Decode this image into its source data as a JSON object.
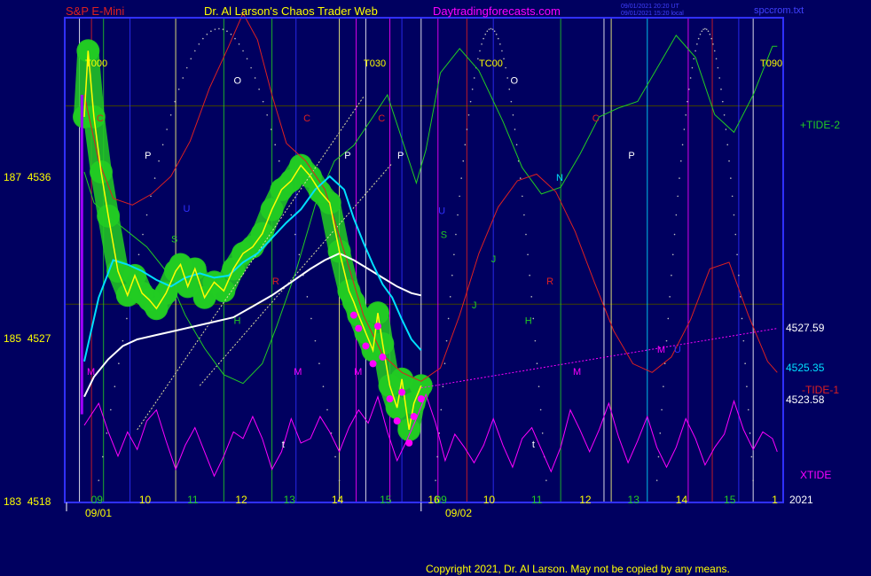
{
  "header": {
    "instrument": "S&P E-Mini",
    "author": "Dr. Al Larson's Chaos Trader Web",
    "site": "Daytradingforecasts.com",
    "stamp_line1": "09/01/2021 20:20 UT",
    "stamp_line2": "09/01/2021 15:20 local",
    "file": "spccrom.txt"
  },
  "footer": {
    "copyright": "Copyright 2021, Dr. Al Larson. May not be copied by any means."
  },
  "colors": {
    "background": "#000060",
    "frame": "#3030ff",
    "price": "#ffff00",
    "band": "#22cc22",
    "ma_fast": "#00e0ff",
    "ma_slow": "#ffffff",
    "tide_plus": "#22cc22",
    "tide_minus": "#dd2020",
    "xtide": "#ff00ff",
    "stamp": "#4040ff"
  },
  "chart_data": {
    "type": "line",
    "y_axis": {
      "range": [
        4518,
        4540
      ],
      "ticks": [
        {
          "value": 4536,
          "label": "187  4536"
        },
        {
          "value": 4527,
          "label": "185  4527"
        },
        {
          "value": 4518,
          "label": "183  4518"
        }
      ]
    },
    "x_axis": {
      "hours_day1": [
        "09",
        "10",
        "11",
        "12",
        "13",
        "14",
        "15",
        "16"
      ],
      "hours_day2": [
        "09",
        "10",
        "11",
        "12",
        "13",
        "14",
        "15",
        "1"
      ],
      "dates": [
        "09/01",
        "09/02"
      ],
      "year": "2021"
    },
    "time_markers": [
      "T000",
      "T030",
      "TC00",
      "T090"
    ],
    "series": [
      {
        "name": "+TIDE-2"
      },
      {
        "name": "-TIDE-1"
      },
      {
        "name": "XTIDE"
      }
    ],
    "value_labels": [
      "4527.59",
      "4525.35",
      "4523.58"
    ],
    "planet_letters": [
      "C",
      "P",
      "O",
      "U",
      "S",
      "H",
      "R",
      "M",
      "M",
      "M",
      "C",
      "P",
      "C",
      "P",
      "U",
      "S",
      "J",
      "O",
      "H",
      "N",
      "R",
      "M",
      "C",
      "P",
      "J",
      "t",
      "t",
      "U",
      "M"
    ],
    "price": [
      {
        "t": 0.0,
        "v": 4535.5
      },
      {
        "t": 0.08,
        "v": 4538.5
      },
      {
        "t": 0.2,
        "v": 4535.5
      },
      {
        "t": 0.35,
        "v": 4533
      },
      {
        "t": 0.5,
        "v": 4531
      },
      {
        "t": 0.7,
        "v": 4528.5
      },
      {
        "t": 0.9,
        "v": 4527.4
      },
      {
        "t": 1.05,
        "v": 4528.3
      },
      {
        "t": 1.2,
        "v": 4527.5
      },
      {
        "t": 1.35,
        "v": 4527.2
      },
      {
        "t": 1.5,
        "v": 4526.8
      },
      {
        "t": 1.7,
        "v": 4527.5
      },
      {
        "t": 1.9,
        "v": 4528.5
      },
      {
        "t": 2.0,
        "v": 4528.8
      },
      {
        "t": 2.15,
        "v": 4527.8
      },
      {
        "t": 2.3,
        "v": 4528.6
      },
      {
        "t": 2.5,
        "v": 4527.3
      },
      {
        "t": 2.7,
        "v": 4528
      },
      {
        "t": 2.9,
        "v": 4527.6
      },
      {
        "t": 3.1,
        "v": 4528.6
      },
      {
        "t": 3.3,
        "v": 4529.3
      },
      {
        "t": 3.5,
        "v": 4529.6
      },
      {
        "t": 3.7,
        "v": 4530.2
      },
      {
        "t": 3.9,
        "v": 4531.3
      },
      {
        "t": 4.1,
        "v": 4532.2
      },
      {
        "t": 4.3,
        "v": 4532.6
      },
      {
        "t": 4.5,
        "v": 4533.3
      },
      {
        "t": 4.7,
        "v": 4532.8
      },
      {
        "t": 4.9,
        "v": 4532.1
      },
      {
        "t": 5.1,
        "v": 4531.6
      },
      {
        "t": 5.3,
        "v": 4529.4
      },
      {
        "t": 5.5,
        "v": 4527.6
      },
      {
        "t": 5.6,
        "v": 4527.1
      },
      {
        "t": 5.7,
        "v": 4526.5
      },
      {
        "t": 5.85,
        "v": 4525.7
      },
      {
        "t": 6.0,
        "v": 4524.9
      },
      {
        "t": 6.1,
        "v": 4526.6
      },
      {
        "t": 6.2,
        "v": 4525.2
      },
      {
        "t": 6.35,
        "v": 4523.3
      },
      {
        "t": 6.5,
        "v": 4522.3
      },
      {
        "t": 6.6,
        "v": 4523.6
      },
      {
        "t": 6.75,
        "v": 4521.3
      },
      {
        "t": 6.85,
        "v": 4522.5
      },
      {
        "t": 7.0,
        "v": 4523.3
      }
    ],
    "ma_fast": [
      {
        "t": 0.0,
        "v": 4524.4
      },
      {
        "t": 0.3,
        "v": 4527.3
      },
      {
        "t": 0.6,
        "v": 4529
      },
      {
        "t": 0.9,
        "v": 4528.8
      },
      {
        "t": 1.2,
        "v": 4528.5
      },
      {
        "t": 1.5,
        "v": 4528.1
      },
      {
        "t": 1.8,
        "v": 4527.8
      },
      {
        "t": 2.1,
        "v": 4528.2
      },
      {
        "t": 2.4,
        "v": 4528.4
      },
      {
        "t": 2.7,
        "v": 4528.2
      },
      {
        "t": 3.0,
        "v": 4528.3
      },
      {
        "t": 3.3,
        "v": 4528.9
      },
      {
        "t": 3.6,
        "v": 4529.3
      },
      {
        "t": 3.9,
        "v": 4530
      },
      {
        "t": 4.2,
        "v": 4530.7
      },
      {
        "t": 4.5,
        "v": 4531.3
      },
      {
        "t": 4.8,
        "v": 4532.2
      },
      {
        "t": 5.1,
        "v": 4532.8
      },
      {
        "t": 5.4,
        "v": 4532.2
      },
      {
        "t": 5.6,
        "v": 4530.9
      },
      {
        "t": 5.8,
        "v": 4529.8
      },
      {
        "t": 6.0,
        "v": 4528.8
      },
      {
        "t": 6.2,
        "v": 4527.9
      },
      {
        "t": 6.4,
        "v": 4527.3
      },
      {
        "t": 6.6,
        "v": 4526.3
      },
      {
        "t": 6.8,
        "v": 4525.4
      },
      {
        "t": 7.0,
        "v": 4524.9
      }
    ],
    "ma_slow": [
      {
        "t": 0.0,
        "v": 4522.8
      },
      {
        "t": 0.2,
        "v": 4523.7
      },
      {
        "t": 0.5,
        "v": 4524.5
      },
      {
        "t": 0.8,
        "v": 4525.1
      },
      {
        "t": 1.1,
        "v": 4525.4
      },
      {
        "t": 1.5,
        "v": 4525.6
      },
      {
        "t": 1.9,
        "v": 4525.8
      },
      {
        "t": 2.3,
        "v": 4526
      },
      {
        "t": 2.7,
        "v": 4526.2
      },
      {
        "t": 3.1,
        "v": 4526.4
      },
      {
        "t": 3.5,
        "v": 4526.9
      },
      {
        "t": 3.9,
        "v": 4527.4
      },
      {
        "t": 4.3,
        "v": 4528
      },
      {
        "t": 4.7,
        "v": 4528.6
      },
      {
        "t": 5.0,
        "v": 4529
      },
      {
        "t": 5.3,
        "v": 4529.3
      },
      {
        "t": 5.6,
        "v": 4529
      },
      {
        "t": 5.9,
        "v": 4528.6
      },
      {
        "t": 6.2,
        "v": 4528.2
      },
      {
        "t": 6.5,
        "v": 4527.8
      },
      {
        "t": 6.8,
        "v": 4527.5
      },
      {
        "t": 7.0,
        "v": 4527.4
      }
    ],
    "tide_plus": [
      {
        "t": 0.0,
        "v": 4533
      },
      {
        "t": 0.2,
        "v": 4531.6
      },
      {
        "t": 0.5,
        "v": 4531
      },
      {
        "t": 0.9,
        "v": 4530.3
      },
      {
        "t": 1.3,
        "v": 4529.6
      },
      {
        "t": 1.7,
        "v": 4528.5
      },
      {
        "t": 2.1,
        "v": 4526.5
      },
      {
        "t": 2.5,
        "v": 4525
      },
      {
        "t": 2.9,
        "v": 4523.8
      },
      {
        "t": 3.3,
        "v": 4523.4
      },
      {
        "t": 3.7,
        "v": 4524.3
      },
      {
        "t": 4.0,
        "v": 4526
      },
      {
        "t": 4.4,
        "v": 4528.5
      },
      {
        "t": 4.8,
        "v": 4531.5
      },
      {
        "t": 5.2,
        "v": 4533.5
      },
      {
        "t": 5.6,
        "v": 4534.2
      },
      {
        "t": 6.0,
        "v": 4535.5
      },
      {
        "t": 6.3,
        "v": 4536.5
      },
      {
        "t": 6.6,
        "v": 4534.5
      },
      {
        "t": 6.9,
        "v": 4532.5
      },
      {
        "t": 7.1,
        "v": 4534
      },
      {
        "t": 7.4,
        "v": 4537.5
      },
      {
        "t": 7.8,
        "v": 4538.6
      },
      {
        "t": 8.2,
        "v": 4537.6
      },
      {
        "t": 8.7,
        "v": 4535.3
      },
      {
        "t": 9.1,
        "v": 4533.2
      },
      {
        "t": 9.5,
        "v": 4532
      },
      {
        "t": 9.9,
        "v": 4532.3
      },
      {
        "t": 10.3,
        "v": 4533.8
      },
      {
        "t": 10.7,
        "v": 4535.5
      },
      {
        "t": 11.1,
        "v": 4535.9
      },
      {
        "t": 11.5,
        "v": 4536.2
      },
      {
        "t": 11.9,
        "v": 4537.7
      },
      {
        "t": 12.3,
        "v": 4539.2
      },
      {
        "t": 12.7,
        "v": 4538.2
      },
      {
        "t": 13.1,
        "v": 4535.6
      },
      {
        "t": 13.5,
        "v": 4534.8
      },
      {
        "t": 13.9,
        "v": 4536.5
      },
      {
        "t": 14.3,
        "v": 4538.7
      },
      {
        "t": 14.4,
        "v": 4538.7
      }
    ],
    "tide_minus": [
      {
        "t": 0.0,
        "v": 4536.5
      },
      {
        "t": 0.3,
        "v": 4533.5
      },
      {
        "t": 0.6,
        "v": 4531.8
      },
      {
        "t": 1.0,
        "v": 4531.5
      },
      {
        "t": 1.4,
        "v": 4532
      },
      {
        "t": 1.8,
        "v": 4532.8
      },
      {
        "t": 2.2,
        "v": 4534.4
      },
      {
        "t": 2.6,
        "v": 4536.8
      },
      {
        "t": 3.0,
        "v": 4538.7
      },
      {
        "t": 3.3,
        "v": 4540.2
      },
      {
        "t": 3.6,
        "v": 4539
      },
      {
        "t": 3.9,
        "v": 4536.5
      },
      {
        "t": 4.2,
        "v": 4534.3
      },
      {
        "t": 4.6,
        "v": 4533.5
      },
      {
        "t": 5.0,
        "v": 4532.2
      },
      {
        "t": 5.4,
        "v": 4529.4
      },
      {
        "t": 5.8,
        "v": 4526.5
      },
      {
        "t": 6.2,
        "v": 4524.7
      },
      {
        "t": 6.6,
        "v": 4523.9
      },
      {
        "t": 7.0,
        "v": 4523.5
      },
      {
        "t": 7.4,
        "v": 4524.1
      },
      {
        "t": 7.8,
        "v": 4526.5
      },
      {
        "t": 8.2,
        "v": 4529.3
      },
      {
        "t": 8.6,
        "v": 4531.4
      },
      {
        "t": 9.0,
        "v": 4532.6
      },
      {
        "t": 9.4,
        "v": 4532.9
      },
      {
        "t": 9.8,
        "v": 4532.1
      },
      {
        "t": 10.2,
        "v": 4530.3
      },
      {
        "t": 10.6,
        "v": 4528
      },
      {
        "t": 11.0,
        "v": 4525.8
      },
      {
        "t": 11.4,
        "v": 4524.3
      },
      {
        "t": 11.8,
        "v": 4523.9
      },
      {
        "t": 12.2,
        "v": 4524.6
      },
      {
        "t": 12.6,
        "v": 4526.3
      },
      {
        "t": 13.0,
        "v": 4528.6
      },
      {
        "t": 13.4,
        "v": 4528.9
      },
      {
        "t": 13.8,
        "v": 4526.5
      },
      {
        "t": 14.2,
        "v": 4524.4
      },
      {
        "t": 14.4,
        "v": 4523.9
      }
    ],
    "xtide": [
      {
        "t": 0.0,
        "v": 4521.5
      },
      {
        "t": 0.3,
        "v": 4522.5
      },
      {
        "t": 0.5,
        "v": 4521.2
      },
      {
        "t": 0.7,
        "v": 4520.1
      },
      {
        "t": 0.9,
        "v": 4521.2
      },
      {
        "t": 1.1,
        "v": 4520.4
      },
      {
        "t": 1.3,
        "v": 4521.7
      },
      {
        "t": 1.5,
        "v": 4522.2
      },
      {
        "t": 1.7,
        "v": 4520.8
      },
      {
        "t": 1.9,
        "v": 4519.5
      },
      {
        "t": 2.1,
        "v": 4520.6
      },
      {
        "t": 2.3,
        "v": 4521.4
      },
      {
        "t": 2.5,
        "v": 4520.3
      },
      {
        "t": 2.7,
        "v": 4519.2
      },
      {
        "t": 2.9,
        "v": 4520.1
      },
      {
        "t": 3.1,
        "v": 4521.2
      },
      {
        "t": 3.3,
        "v": 4520.9
      },
      {
        "t": 3.5,
        "v": 4521.9
      },
      {
        "t": 3.7,
        "v": 4520.9
      },
      {
        "t": 3.9,
        "v": 4519.5
      },
      {
        "t": 4.1,
        "v": 4520.3
      },
      {
        "t": 4.3,
        "v": 4521.8
      },
      {
        "t": 4.5,
        "v": 4520.7
      },
      {
        "t": 4.7,
        "v": 4520.9
      },
      {
        "t": 4.9,
        "v": 4521.9
      },
      {
        "t": 5.1,
        "v": 4521.2
      },
      {
        "t": 5.3,
        "v": 4520.3
      },
      {
        "t": 5.5,
        "v": 4521.4
      },
      {
        "t": 5.7,
        "v": 4522.2
      },
      {
        "t": 5.9,
        "v": 4521.6
      },
      {
        "t": 6.1,
        "v": 4522.8
      },
      {
        "t": 6.3,
        "v": 4521.2
      },
      {
        "t": 6.5,
        "v": 4519.9
      },
      {
        "t": 6.7,
        "v": 4520.8
      },
      {
        "t": 6.9,
        "v": 4521.8
      },
      {
        "t": 7.1,
        "v": 4522.9
      },
      {
        "t": 7.3,
        "v": 4521.6
      },
      {
        "t": 7.5,
        "v": 4519.9
      },
      {
        "t": 7.7,
        "v": 4521.1
      },
      {
        "t": 7.9,
        "v": 4520.5
      },
      {
        "t": 8.1,
        "v": 4519.8
      },
      {
        "t": 8.3,
        "v": 4520.6
      },
      {
        "t": 8.5,
        "v": 4521.8
      },
      {
        "t": 8.7,
        "v": 4520.6
      },
      {
        "t": 8.9,
        "v": 4519.6
      },
      {
        "t": 9.1,
        "v": 4520.9
      },
      {
        "t": 9.3,
        "v": 4521.4
      },
      {
        "t": 9.5,
        "v": 4520.4
      },
      {
        "t": 9.7,
        "v": 4519.4
      },
      {
        "t": 9.9,
        "v": 4520.5
      },
      {
        "t": 10.1,
        "v": 4522.2
      },
      {
        "t": 10.3,
        "v": 4521.3
      },
      {
        "t": 10.5,
        "v": 4520.3
      },
      {
        "t": 10.7,
        "v": 4521.3
      },
      {
        "t": 10.9,
        "v": 4522.5
      },
      {
        "t": 11.1,
        "v": 4521
      },
      {
        "t": 11.3,
        "v": 4519.8
      },
      {
        "t": 11.5,
        "v": 4520.8
      },
      {
        "t": 11.7,
        "v": 4521.9
      },
      {
        "t": 11.9,
        "v": 4520.5
      },
      {
        "t": 12.1,
        "v": 4519.6
      },
      {
        "t": 12.3,
        "v": 4520.5
      },
      {
        "t": 12.5,
        "v": 4521.8
      },
      {
        "t": 12.7,
        "v": 4520.9
      },
      {
        "t": 12.9,
        "v": 4519.7
      },
      {
        "t": 13.1,
        "v": 4520.5
      },
      {
        "t": 13.3,
        "v": 4521.1
      },
      {
        "t": 13.5,
        "v": 4522.6
      },
      {
        "t": 13.7,
        "v": 4521.3
      },
      {
        "t": 13.9,
        "v": 4520.4
      },
      {
        "t": 14.1,
        "v": 4521.2
      },
      {
        "t": 14.3,
        "v": 4520.9
      },
      {
        "t": 14.4,
        "v": 4520.3
      }
    ],
    "trend_lines": [
      {
        "from": {
          "t": 1.1,
          "v": 4521.3
        },
        "to": {
          "t": 5.8,
          "v": 4536.4
        },
        "color": "#e0e0a0"
      },
      {
        "from": {
          "t": 2.4,
          "v": 4523.3
        },
        "to": {
          "t": 6.4,
          "v": 4533.4
        },
        "color": "#e0e0a0"
      },
      {
        "from": {
          "t": 7.0,
          "v": 4523.2
        },
        "to": {
          "t": 14.4,
          "v": 4525.9
        },
        "color": "#ff00ff"
      }
    ],
    "cycle_lines": [
      {
        "t": -0.1,
        "color": "#ffffff"
      },
      {
        "t": 0.15,
        "color": "#dd2020"
      },
      {
        "t": 0.4,
        "color": "#22cc22"
      },
      {
        "t": 0.95,
        "color": "#3030ff"
      },
      {
        "t": 1.9,
        "color": "#ffff80"
      },
      {
        "t": 2.9,
        "color": "#22cc22"
      },
      {
        "t": 3.9,
        "color": "#22cc22"
      },
      {
        "t": 4.4,
        "color": "#3030ff"
      },
      {
        "t": 5.3,
        "color": "#ffff80"
      },
      {
        "t": 5.65,
        "color": "#ff00ff"
      },
      {
        "t": 5.85,
        "color": "#ffffff"
      },
      {
        "t": 6.35,
        "color": "#ff00ff"
      },
      {
        "t": 6.6,
        "color": "#3030ff"
      },
      {
        "t": 7.0,
        "color": "#ffffff"
      },
      {
        "t": 7.35,
        "color": "#ff00ff"
      },
      {
        "t": 7.95,
        "color": "#dd2020"
      },
      {
        "t": 8.5,
        "color": "#3030ff"
      },
      {
        "t": 9.9,
        "color": "#22cc22"
      },
      {
        "t": 10.8,
        "color": "#ffffff"
      },
      {
        "t": 10.95,
        "color": "#ffff80"
      },
      {
        "t": 11.7,
        "color": "#00e0ff"
      },
      {
        "t": 12.55,
        "color": "#ff00ff"
      },
      {
        "t": 13.05,
        "color": "#dd2020"
      },
      {
        "t": 13.6,
        "color": "#3030ff"
      },
      {
        "t": 13.9,
        "color": "#ffffff"
      }
    ]
  }
}
